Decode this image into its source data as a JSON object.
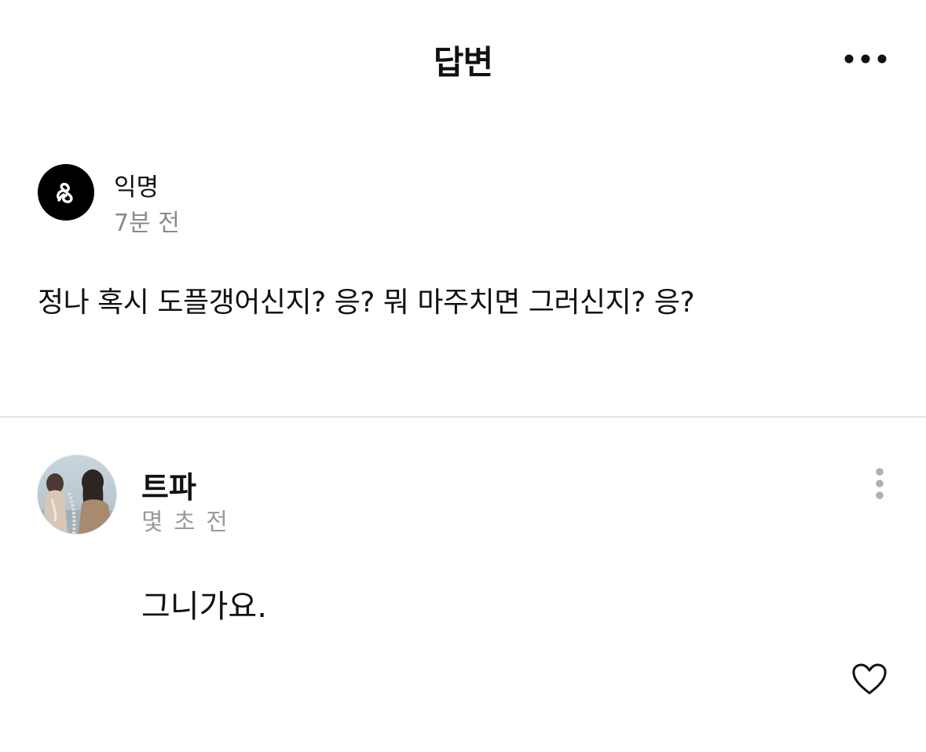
{
  "header": {
    "title": "답변",
    "more_icon": "more-horizontal-icon"
  },
  "question": {
    "avatar_icon": "anonymous-logo-icon",
    "author": "익명",
    "time": "7분 전",
    "text": "정나 혹시 도플갱어신지? 응? 뭐 마주치면 그러신지? 응?"
  },
  "answer": {
    "author": "트파",
    "time": "몇 초 전",
    "text": "그니가요.",
    "menu_icon": "more-vertical-icon",
    "like_icon": "heart-icon"
  },
  "colors": {
    "text": "#111111",
    "muted": "#8a8a8a",
    "divider": "#e6e6e6",
    "icon": "#b0b0b0"
  }
}
